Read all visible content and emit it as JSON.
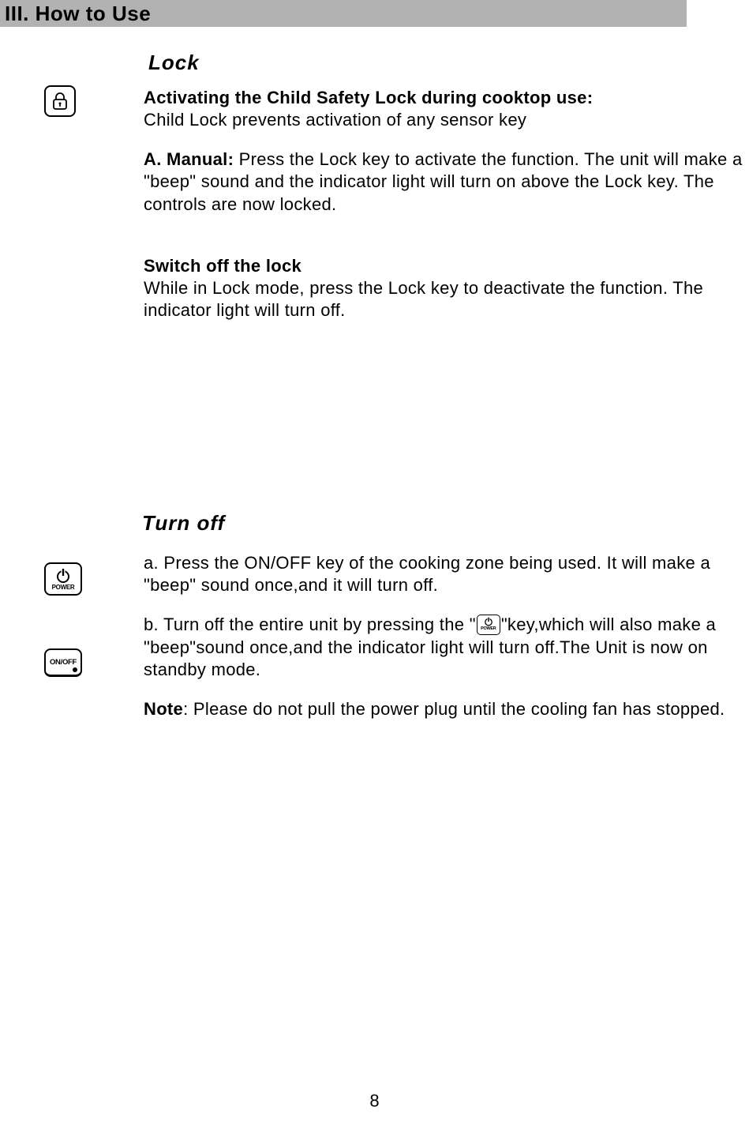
{
  "header": "III.  How to Use",
  "lock": {
    "title": "Lock",
    "activating_heading": "Activating the Child Safety Lock during cooktop use:",
    "activating_sub": "Child Lock prevents activation of any sensor key",
    "manual_heading": "A. Manual: ",
    "manual_body": "Press the Lock key to activate the function. The unit will make a \"beep\" sound and the indicator light will turn on above the Lock key. The controls are now locked.",
    "switch_heading": "Switch off the lock",
    "switch_body": "While in Lock mode, press the Lock key to deactivate the function. The indicator light will turn off."
  },
  "turnoff": {
    "title": "Turn off",
    "a": "a. Press the ON/OFF key of the cooking zone being used. It will make a \"beep\" sound once,and it will turn off.",
    "b_pre": "b. Turn off the entire unit by pressing the \"",
    "b_post": "\"key,which will  also make a \"beep\"sound once,and the indicator light will turn off.The Unit is now on standby mode.",
    "note_heading": "Note",
    "note_body": ": Please do not pull the power plug until the cooling fan has stopped."
  },
  "icons": {
    "power_label": "POWER",
    "onoff_label": "ON/OFF"
  },
  "page_number": "8"
}
